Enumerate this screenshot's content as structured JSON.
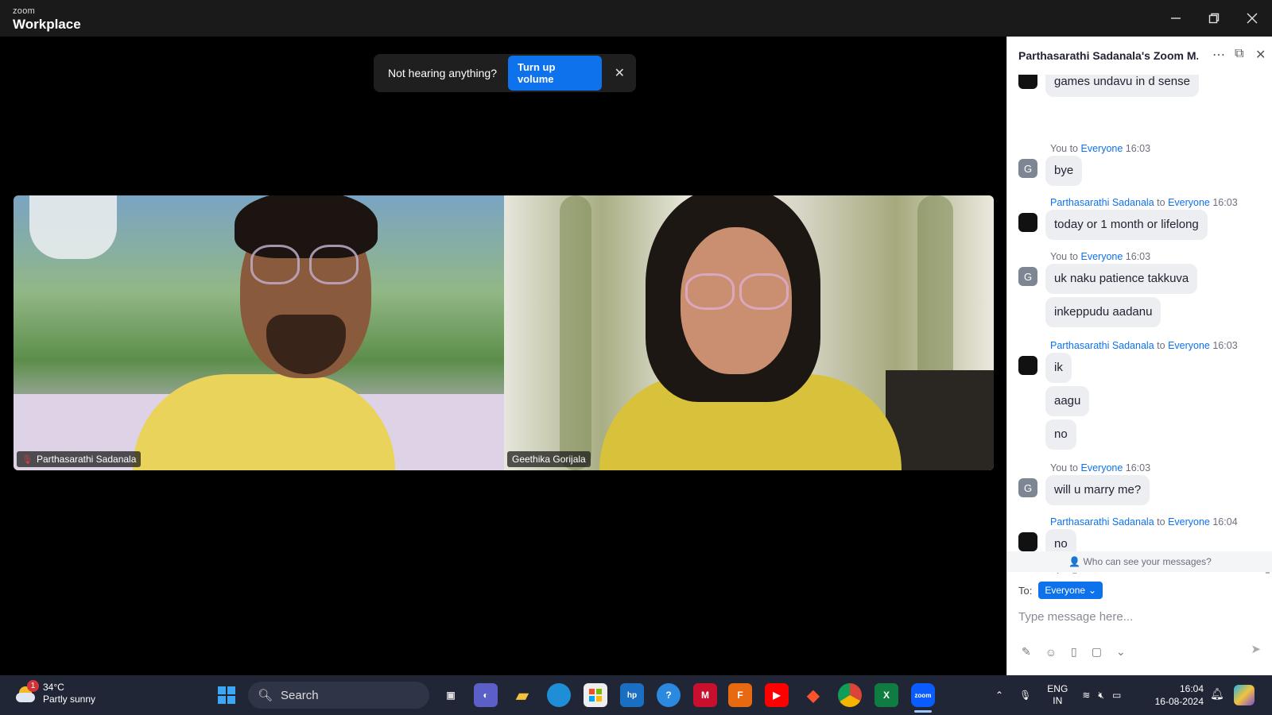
{
  "app": {
    "brand_top": "zoom",
    "brand_main": "Workplace"
  },
  "toast": {
    "text": "Not hearing anything?",
    "button": "Turn up volume"
  },
  "videos": [
    {
      "name": "Parthasarathi Sadanala"
    },
    {
      "name": "Geethika Gorijala"
    }
  ],
  "chat": {
    "title": "Parthasarathi Sadanala's Zoom M...",
    "messages": [
      {
        "sender": "",
        "to": "",
        "time": "",
        "avatar": "dark",
        "bubbles": [
          "games undavu in d sense"
        ]
      },
      {
        "sender": "You",
        "to": "Everyone",
        "time": "16:03",
        "avatar": "G",
        "bubbles": [
          "bye"
        ]
      },
      {
        "sender": "Parthasarathi Sadanala",
        "to": "Everyone",
        "time": "16:03",
        "avatar": "dark",
        "bubbles": [
          "today or 1 month or lifelong"
        ]
      },
      {
        "sender": "You",
        "to": "Everyone",
        "time": "16:03",
        "avatar": "G",
        "bubbles": [
          "uk naku patience takkuva",
          "inkeppudu aadanu"
        ]
      },
      {
        "sender": "Parthasarathi Sadanala",
        "to": "Everyone",
        "time": "16:03",
        "avatar": "dark",
        "bubbles": [
          "ik",
          "aagu",
          "no"
        ]
      },
      {
        "sender": "You",
        "to": "Everyone",
        "time": "16:03",
        "avatar": "G",
        "bubbles": [
          "will u marry me?"
        ]
      },
      {
        "sender": "Parthasarathi Sadanala",
        "to": "Everyone",
        "time": "16:04",
        "avatar": "dark",
        "bubbles": [
          "no"
        ]
      }
    ],
    "to_word": "to",
    "who_can_see": "Who can see your messages?",
    "to_label": "To:",
    "recipient": "Everyone",
    "input_placeholder": "Type message here..."
  },
  "taskbar": {
    "weather_badge": "1",
    "temperature": "34°C",
    "weather_desc": "Partly sunny",
    "search_label": "Search",
    "lang_top": "ENG",
    "lang_bottom": "IN",
    "time": "16:04",
    "date": "16-08-2024"
  },
  "colors": {
    "accent": "#0e72ed",
    "titlebar": "#1a1a1a",
    "taskbar": "#202635"
  }
}
